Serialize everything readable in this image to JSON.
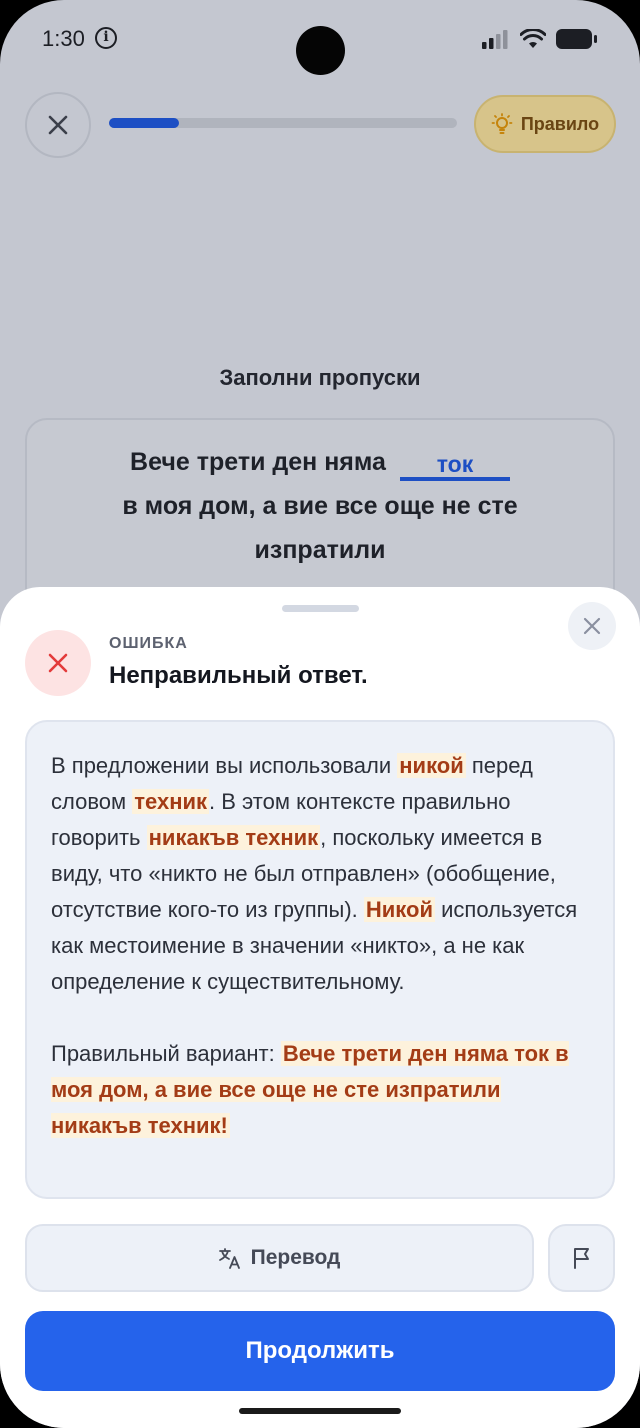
{
  "status_bar": {
    "time": "1:30",
    "info_glyph": "i",
    "icons": [
      "info-icon",
      "signal-icon",
      "wifi-icon",
      "battery-icon"
    ]
  },
  "header": {
    "rule_label": "Правило",
    "rule_icon": "lightbulb-icon",
    "close_icon": "close-icon",
    "progress_fraction": 0.2
  },
  "task": {
    "title": "Заполни пропуски",
    "line1": "Вече трети ден няма",
    "answer": "ток",
    "line2": "в моя дом, а вие все още не сте",
    "line3": "изпратили"
  },
  "feedback": {
    "label": "ОШИБКА",
    "title": "Неправильный ответ.",
    "explanation": {
      "p1": "В предложении вы использовали ",
      "hl1": "никой",
      "p2": " перед словом ",
      "hl2": "техник",
      "p3": ". В этом контексте правильно говорить ",
      "hl3": "никакъв техник",
      "p4": ", поскольку имеется в виду, что «никто не был отправлен» (обобщение, отсутствие кого-то из группы). ",
      "hl4": "Никой",
      "p5": " используется как местоимение в значении «никто», а не как определение к существительному.",
      "correct_prefix": "Правильный вариант: ",
      "correct_text": "Вече трети ден няма ток в моя дом, а вие все още не сте изпратили никакъв техник!"
    }
  },
  "actions": {
    "translate_label": "Перевод",
    "translate_icon": "translate-icon",
    "flag_icon": "flag-icon",
    "continue_label": "Продолжить"
  },
  "colors": {
    "accent": "#2563eb",
    "error": "#e33b3b",
    "highlight_text": "#a33c16",
    "highlight_bg": "#fdf2dc"
  }
}
